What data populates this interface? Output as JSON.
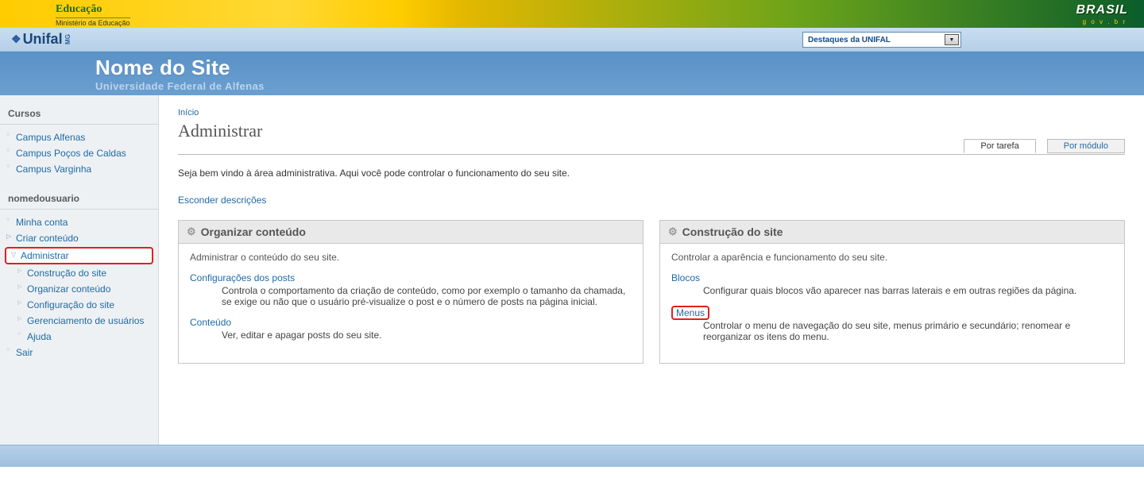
{
  "gov": {
    "dept": "Educação",
    "ministry": "Ministério da Educação",
    "brand": "BRASIL",
    "brand_sub": "g o v . b r"
  },
  "unifal": {
    "name": "Unifal",
    "region": "MG",
    "dropdown_label": "Destaques da UNIFAL"
  },
  "header": {
    "site_title": "Nome do Site",
    "site_subtitle": "Universidade Federal de Alfenas"
  },
  "sidebar": {
    "group_cursos_title": "Cursos",
    "cursos": [
      "Campus Alfenas",
      "Campus Poços de Caldas",
      "Campus Varginha"
    ],
    "group_user_title": "nomedousuario",
    "user_items": {
      "minha_conta": "Minha conta",
      "criar_conteudo": "Criar conteúdo",
      "administrar": "Administrar",
      "sub": {
        "construcao": "Construção do site",
        "organizar": "Organizar conteúdo",
        "config": "Configuração do site",
        "gerenciar": "Gerenciamento de usuários",
        "ajuda": "Ajuda"
      },
      "sair": "Sair"
    }
  },
  "main": {
    "breadcrumb": "Início",
    "title": "Administrar",
    "tabs": {
      "por_tarefa": "Por tarefa",
      "por_modulo": "Por módulo"
    },
    "intro": "Seja bem vindo à área administrativa. Aqui você pode controlar o funcionamento do seu site.",
    "hide_desc": "Esconder descrições",
    "panels": {
      "organizar": {
        "title": "Organizar conteúdo",
        "subtitle": "Administrar o conteúdo do seu site.",
        "sec1_link": "Configurações dos posts",
        "sec1_desc": "Controla o comportamento da criação de conteúdo, como por exemplo o tamanho da chamada, se exige ou não que o usuário pré-visualize o post e o número de posts na página inicial.",
        "sec2_link": "Conteúdo",
        "sec2_desc": "Ver, editar e apagar posts do seu site."
      },
      "construcao": {
        "title": "Construção do site",
        "subtitle": "Controlar a aparência e funcionamento do seu site.",
        "sec1_link": "Blocos",
        "sec1_desc": "Configurar quais blocos vão aparecer nas barras laterais e em outras regiões da página.",
        "sec2_link": "Menus",
        "sec2_desc": "Controlar o menu de navegação do seu site, menus primário e secundário; renomear e reorganizar os itens do menu."
      }
    }
  }
}
